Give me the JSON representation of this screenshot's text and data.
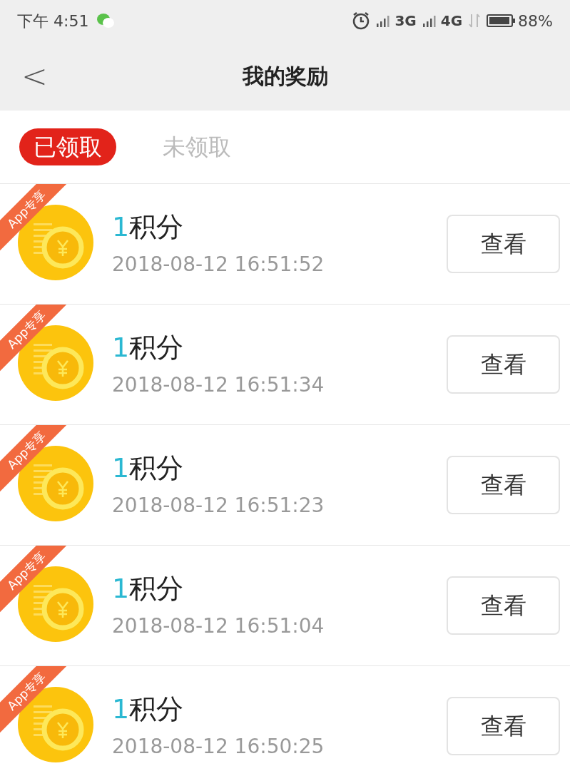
{
  "status_bar": {
    "time": "下午 4:51",
    "network_1": "3G",
    "network_2": "4G",
    "battery": "88%"
  },
  "header": {
    "back": "<",
    "title": "我的奖励"
  },
  "tabs": [
    {
      "label": "已领取",
      "selected": true
    },
    {
      "label": "未领取",
      "selected": false
    }
  ],
  "rewards": [
    {
      "badge": "App专享",
      "amount": "1",
      "unit": "积分",
      "time": "2018-08-12 16:51:52",
      "button": "查看"
    },
    {
      "badge": "App专享",
      "amount": "1",
      "unit": "积分",
      "time": "2018-08-12 16:51:34",
      "button": "查看"
    },
    {
      "badge": "App专享",
      "amount": "1",
      "unit": "积分",
      "time": "2018-08-12 16:51:23",
      "button": "查看"
    },
    {
      "badge": "App专享",
      "amount": "1",
      "unit": "积分",
      "time": "2018-08-12 16:51:04",
      "button": "查看"
    },
    {
      "badge": "App专享",
      "amount": "1",
      "unit": "积分",
      "time": "2018-08-12 16:50:25",
      "button": "查看"
    }
  ]
}
